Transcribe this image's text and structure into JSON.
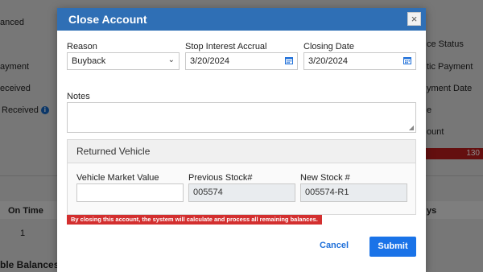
{
  "background": {
    "left_labels": [
      "anced",
      "ayment",
      "eceived",
      "Received"
    ],
    "right_labels": [
      "ce Status",
      "tic Payment",
      "yment Date",
      "e",
      "ount"
    ],
    "red_bar_value": "130",
    "table_header_left": "On Time",
    "table_header_right": "ys",
    "table_cell": "1",
    "section_title": "ble Balances"
  },
  "modal": {
    "title": "Close Account",
    "close_glyph": "×",
    "reason": {
      "label": "Reason",
      "value": "Buyback"
    },
    "stop_interest": {
      "label": "Stop Interest Accrual",
      "value": "3/20/2024"
    },
    "closing_date": {
      "label": "Closing Date",
      "value": "3/20/2024"
    },
    "notes": {
      "label": "Notes",
      "value": ""
    },
    "returned_vehicle": {
      "title": "Returned Vehicle",
      "market_value": {
        "label": "Vehicle Market Value",
        "value": ""
      },
      "previous_stock": {
        "label": "Previous Stock#",
        "value": "005574"
      },
      "new_stock": {
        "label": "New Stock #",
        "value": "005574-R1"
      }
    },
    "warning": "By closing this account, the system will calculate and process all remaining balances.",
    "cancel_label": "Cancel",
    "submit_label": "Submit"
  },
  "colors": {
    "header_blue": "#2f6fb5",
    "primary_button": "#1a73e8",
    "warning_red": "#d32f2f"
  },
  "icons": {
    "calendar": "calendar-icon",
    "chevron": "chevron-down-icon",
    "info": "info-icon"
  }
}
